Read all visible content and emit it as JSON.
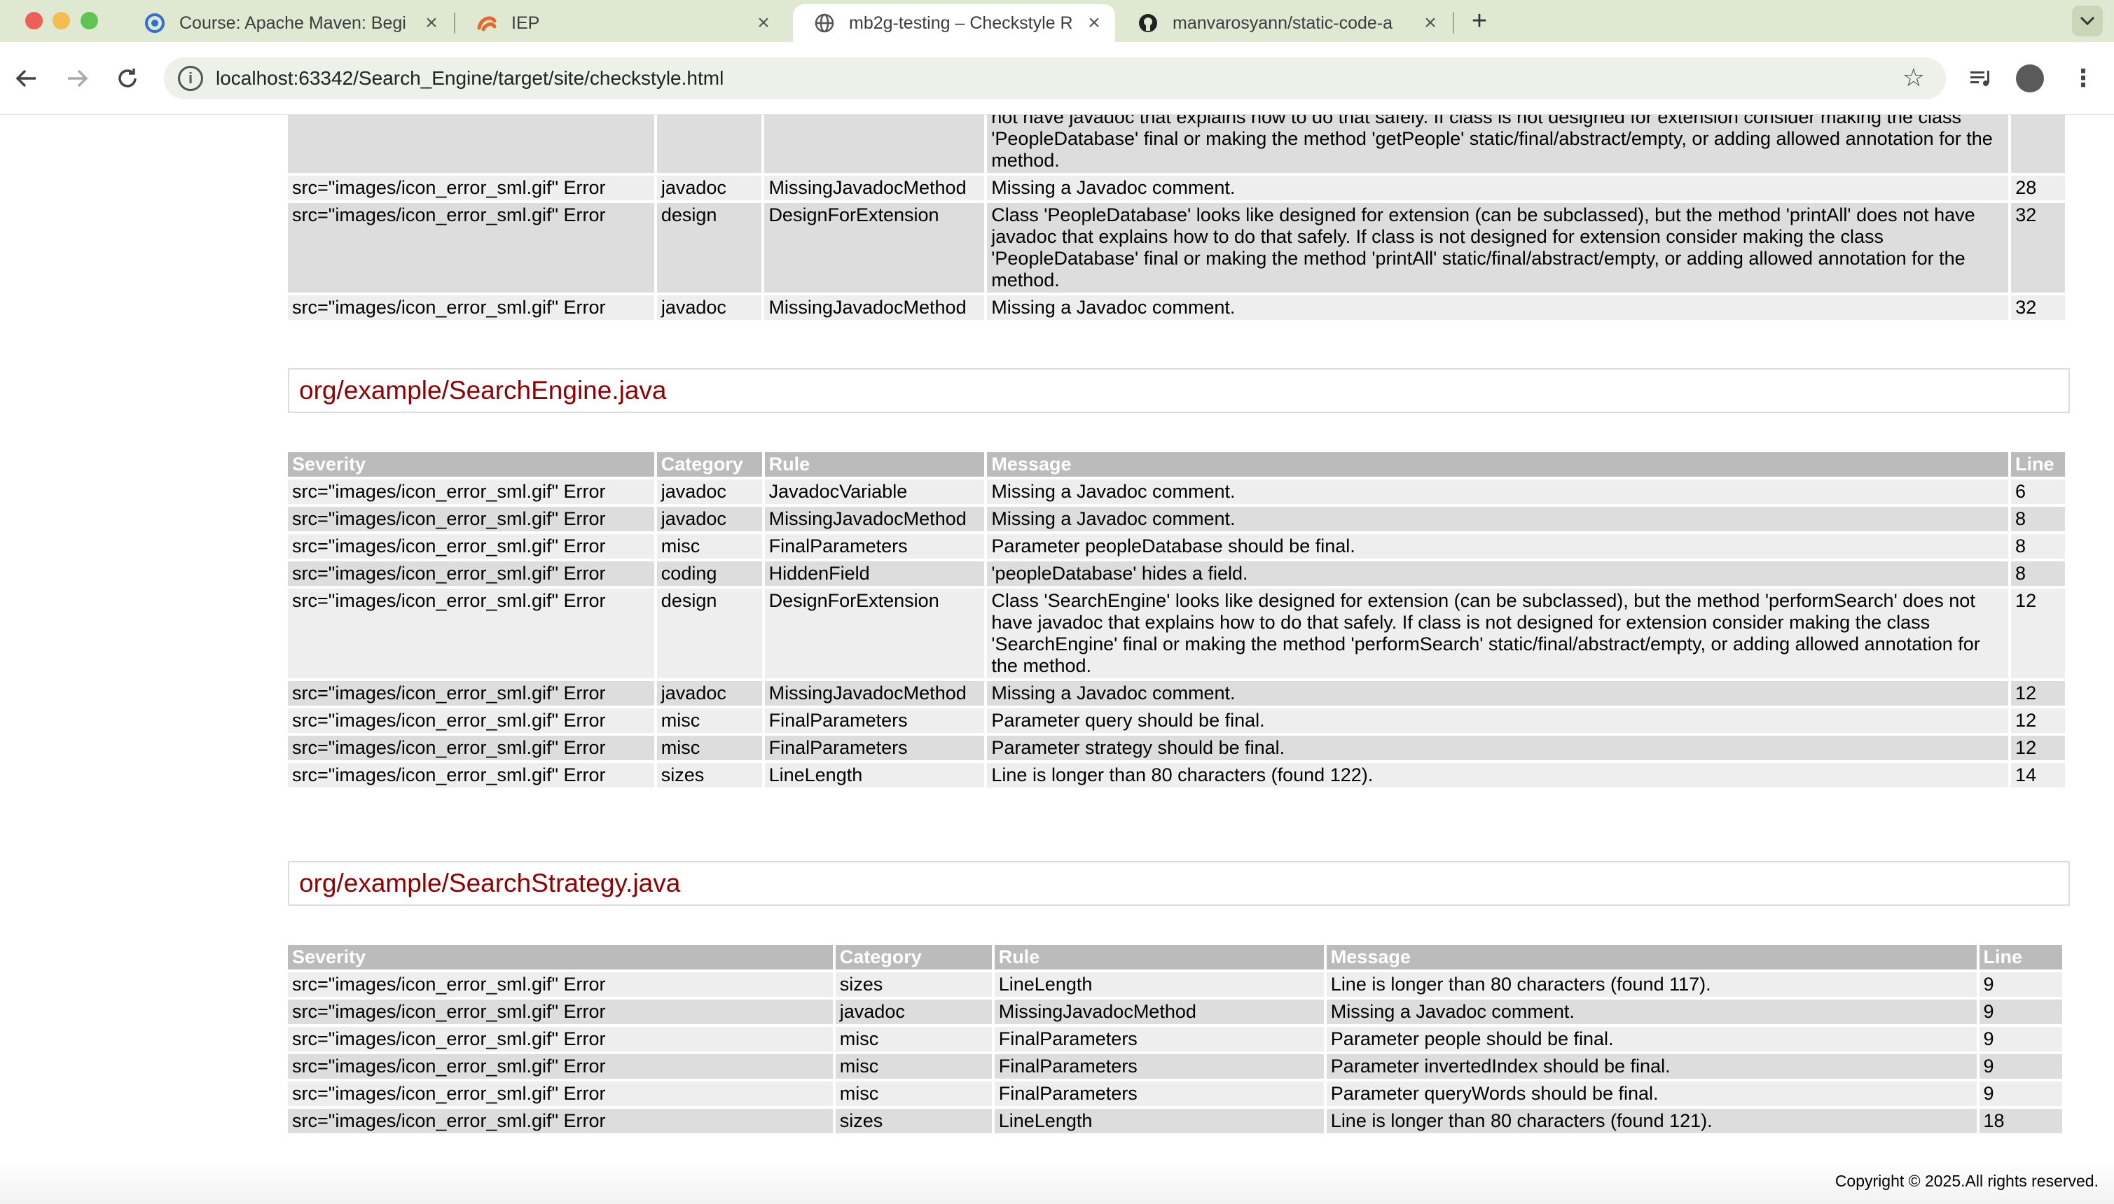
{
  "browser": {
    "tabs": [
      {
        "title": "Course: Apache Maven: Begi",
        "icon": "moodle-icon",
        "active": false
      },
      {
        "title": "IEP",
        "icon": "iep-icon",
        "active": false
      },
      {
        "title": "mb2g-testing – Checkstyle R",
        "icon": "globe-icon",
        "active": true
      },
      {
        "title": "manvarosyann/static-code-a",
        "icon": "github-icon",
        "active": false
      }
    ],
    "url": "localhost:63342/Search_Engine/target/site/checkstyle.html"
  },
  "report": {
    "table_top": {
      "rows": [
        {
          "severity": "src=\"images/icon_error_sml.gif\" Error",
          "category": "javadoc",
          "rule": "MissingJavadocMethod",
          "message": "Missing a Javadoc comment.",
          "line": "28"
        },
        {
          "severity": "src=\"images/icon_error_sml.gif\" Error",
          "category": "design",
          "rule": "DesignForExtension",
          "message": "Class 'PeopleDatabase' looks like designed for extension (can be subclassed), but the method 'printAll' does not have javadoc that explains how to do that safely. If class is not designed for extension consider making the class 'PeopleDatabase' final or making the method 'printAll' static/final/abstract/empty, or adding allowed annotation for the method.",
          "line": "32"
        },
        {
          "severity": "src=\"images/icon_error_sml.gif\" Error",
          "category": "javadoc",
          "rule": "MissingJavadocMethod",
          "message": "Missing a Javadoc comment.",
          "line": "32"
        }
      ],
      "partial_message": "not have javadoc that explains how to do that safely. If class is not designed for extension consider making the class 'PeopleDatabase' final or making the method 'getPeople' static/final/abstract/empty, or adding allowed annotation for the method."
    },
    "sections": [
      {
        "title": "org/example/SearchEngine.java",
        "headers": {
          "severity": "Severity",
          "category": "Category",
          "rule": "Rule",
          "message": "Message",
          "line": "Line"
        },
        "rows": [
          {
            "severity": "src=\"images/icon_error_sml.gif\" Error",
            "category": "javadoc",
            "rule": "JavadocVariable",
            "message": "Missing a Javadoc comment.",
            "line": "6"
          },
          {
            "severity": "src=\"images/icon_error_sml.gif\" Error",
            "category": "javadoc",
            "rule": "MissingJavadocMethod",
            "message": "Missing a Javadoc comment.",
            "line": "8"
          },
          {
            "severity": "src=\"images/icon_error_sml.gif\" Error",
            "category": "misc",
            "rule": "FinalParameters",
            "message": "Parameter peopleDatabase should be final.",
            "line": "8"
          },
          {
            "severity": "src=\"images/icon_error_sml.gif\" Error",
            "category": "coding",
            "rule": "HiddenField",
            "message": "'peopleDatabase' hides a field.",
            "line": "8"
          },
          {
            "severity": "src=\"images/icon_error_sml.gif\" Error",
            "category": "design",
            "rule": "DesignForExtension",
            "message": "Class 'SearchEngine' looks like designed for extension (can be subclassed), but the method 'performSearch' does not have javadoc that explains how to do that safely. If class is not designed for extension consider making the class 'SearchEngine' final or making the method 'performSearch' static/final/abstract/empty, or adding allowed annotation for the method.",
            "line": "12"
          },
          {
            "severity": "src=\"images/icon_error_sml.gif\" Error",
            "category": "javadoc",
            "rule": "MissingJavadocMethod",
            "message": "Missing a Javadoc comment.",
            "line": "12"
          },
          {
            "severity": "src=\"images/icon_error_sml.gif\" Error",
            "category": "misc",
            "rule": "FinalParameters",
            "message": "Parameter query should be final.",
            "line": "12"
          },
          {
            "severity": "src=\"images/icon_error_sml.gif\" Error",
            "category": "misc",
            "rule": "FinalParameters",
            "message": "Parameter strategy should be final.",
            "line": "12"
          },
          {
            "severity": "src=\"images/icon_error_sml.gif\" Error",
            "category": "sizes",
            "rule": "LineLength",
            "message": "Line is longer than 80 characters (found 122).",
            "line": "14"
          }
        ]
      },
      {
        "title": "org/example/SearchStrategy.java",
        "headers": {
          "severity": "Severity",
          "category": "Category",
          "rule": "Rule",
          "message": "Message",
          "line": "Line"
        },
        "rows": [
          {
            "severity": "src=\"images/icon_error_sml.gif\" Error",
            "category": "sizes",
            "rule": "LineLength",
            "message": "Line is longer than 80 characters (found 117).",
            "line": "9"
          },
          {
            "severity": "src=\"images/icon_error_sml.gif\" Error",
            "category": "javadoc",
            "rule": "MissingJavadocMethod",
            "message": "Missing a Javadoc comment.",
            "line": "9"
          },
          {
            "severity": "src=\"images/icon_error_sml.gif\" Error",
            "category": "misc",
            "rule": "FinalParameters",
            "message": "Parameter people should be final.",
            "line": "9"
          },
          {
            "severity": "src=\"images/icon_error_sml.gif\" Error",
            "category": "misc",
            "rule": "FinalParameters",
            "message": "Parameter invertedIndex should be final.",
            "line": "9"
          },
          {
            "severity": "src=\"images/icon_error_sml.gif\" Error",
            "category": "misc",
            "rule": "FinalParameters",
            "message": "Parameter queryWords should be final.",
            "line": "9"
          },
          {
            "severity": "src=\"images/icon_error_sml.gif\" Error",
            "category": "sizes",
            "rule": "LineLength",
            "message": "Line is longer than 80 characters (found 121).",
            "line": "18"
          }
        ]
      }
    ],
    "footer": "Copyright © 2025.All rights reserved."
  },
  "colors": {
    "section_title": "#900000",
    "header_bg": "#bbbbbb",
    "row_a": "#eeeeee",
    "row_b": "#dddddd",
    "tabbar_bg": "#dfe9d2"
  }
}
